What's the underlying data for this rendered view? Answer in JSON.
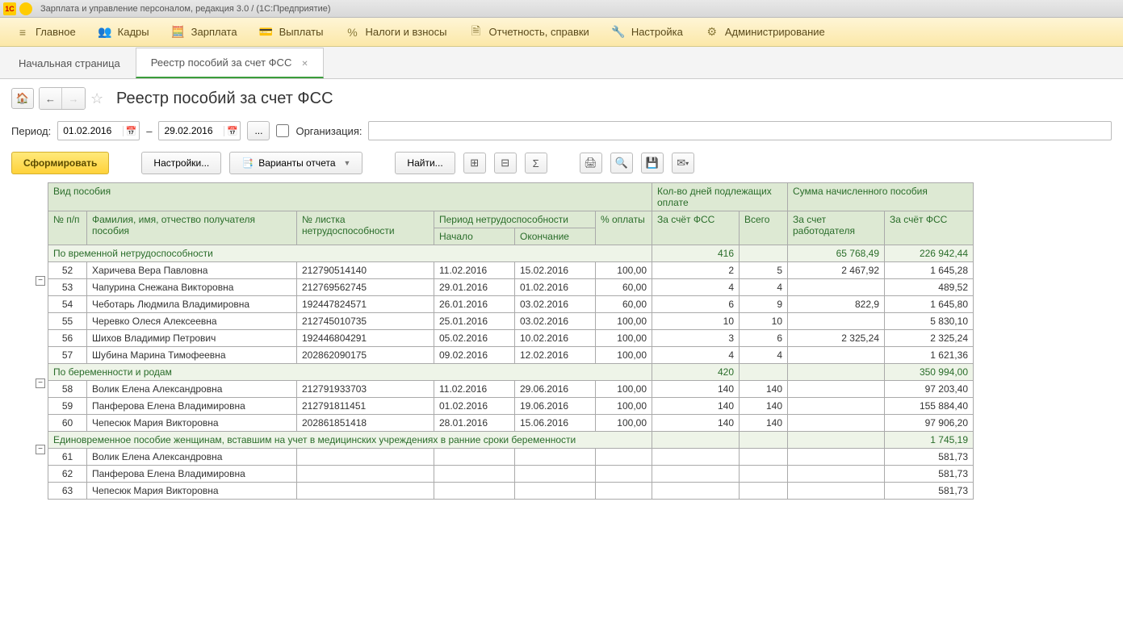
{
  "window": {
    "title": "Зарплата и управление персоналом, редакция 3.0 /                                  (1С:Предприятие)"
  },
  "menu": {
    "items": [
      "Главное",
      "Кадры",
      "Зарплата",
      "Выплаты",
      "Налоги и взносы",
      "Отчетность, справки",
      "Настройка",
      "Администрирование"
    ]
  },
  "tabs": {
    "home": "Начальная страница",
    "active": "Реестр пособий за счет ФСС"
  },
  "page": {
    "title": "Реестр пособий за счет ФСС"
  },
  "filter": {
    "period_label": "Период:",
    "date_from": "01.02.2016",
    "dash": "–",
    "date_to": "29.02.2016",
    "more": "...",
    "org_label": "Организация:"
  },
  "toolbar": {
    "form": "Сформировать",
    "settings": "Настройки...",
    "variants": "Варианты отчета",
    "find": "Найти..."
  },
  "headers": {
    "vid": "Вид пособия",
    "days_group": "Кол-во дней подлежащих оплате",
    "sum_group": "Сумма начисленного пособия",
    "npp": "№ п/п",
    "fio": "Фамилия, имя, отчество получателя пособия",
    "listok": "№ листка нетрудоспособности",
    "period": "Период нетрудоспособности",
    "start": "Начало",
    "end": "Окончание",
    "pct": "% оплаты",
    "days_fss": "За счёт ФСС",
    "days_total": "Всего",
    "sum_emp": "За счет работодателя",
    "sum_fss": "За счёт ФСС"
  },
  "groups": [
    {
      "title": "По временной нетрудоспособности",
      "days_fss": "416",
      "sum_emp": "65 768,49",
      "sum_fss": "226 942,44",
      "rows": [
        {
          "n": "52",
          "fio": "Харичева Вера  Павловна",
          "list": "212790514140",
          "start": "11.02.2016",
          "end": "15.02.2016",
          "pct": "100,00",
          "d1": "2",
          "d2": "5",
          "s1": "2 467,92",
          "s2": "1 645,28"
        },
        {
          "n": "53",
          "fio": "Чапурина Снежана Викторовна",
          "list": "212769562745",
          "start": "29.01.2016",
          "end": "01.02.2016",
          "pct": "60,00",
          "d1": "4",
          "d2": "4",
          "s1": "",
          "s2": "489,52"
        },
        {
          "n": "54",
          "fio": "Чеботарь Людмила Владимировна",
          "list": "192447824571",
          "start": "26.01.2016",
          "end": "03.02.2016",
          "pct": "60,00",
          "d1": "6",
          "d2": "9",
          "s1": "822,9",
          "s2": "1 645,80"
        },
        {
          "n": "55",
          "fio": "Черевко Олеся Алексеевна",
          "list": "212745010735",
          "start": "25.01.2016",
          "end": "03.02.2016",
          "pct": "100,00",
          "d1": "10",
          "d2": "10",
          "s1": "",
          "s2": "5 830,10"
        },
        {
          "n": "56",
          "fio": "Шихов Владимир Петрович",
          "list": "192446804291",
          "start": "05.02.2016",
          "end": "10.02.2016",
          "pct": "100,00",
          "d1": "3",
          "d2": "6",
          "s1": "2 325,24",
          "s2": "2 325,24"
        },
        {
          "n": "57",
          "fio": "Шубина Марина Тимофеевна",
          "list": "202862090175",
          "start": "09.02.2016",
          "end": "12.02.2016",
          "pct": "100,00",
          "d1": "4",
          "d2": "4",
          "s1": "",
          "s2": "1 621,36"
        }
      ]
    },
    {
      "title": "По беременности и родам",
      "days_fss": "420",
      "sum_emp": "",
      "sum_fss": "350 994,00",
      "rows": [
        {
          "n": "58",
          "fio": "Волик Елена Александровна",
          "list": "212791933703",
          "start": "11.02.2016",
          "end": "29.06.2016",
          "pct": "100,00",
          "d1": "140",
          "d2": "140",
          "s1": "",
          "s2": "97 203,40"
        },
        {
          "n": "59",
          "fio": "Панферова Елена Владимировна",
          "list": "212791811451",
          "start": "01.02.2016",
          "end": "19.06.2016",
          "pct": "100,00",
          "d1": "140",
          "d2": "140",
          "s1": "",
          "s2": "155 884,40"
        },
        {
          "n": "60",
          "fio": "Чепесюк Мария Викторовна",
          "list": "202861851418",
          "start": "28.01.2016",
          "end": "15.06.2016",
          "pct": "100,00",
          "d1": "140",
          "d2": "140",
          "s1": "",
          "s2": "97 906,20"
        }
      ]
    },
    {
      "title": "Единовременное пособие женщинам, вставшим на учет в медицинских учреждениях в ранние сроки беременности",
      "days_fss": "",
      "sum_emp": "",
      "sum_fss": "1 745,19",
      "rows": [
        {
          "n": "61",
          "fio": "Волик Елена Александровна",
          "list": "",
          "start": "",
          "end": "",
          "pct": "",
          "d1": "",
          "d2": "",
          "s1": "",
          "s2": "581,73"
        },
        {
          "n": "62",
          "fio": "Панферова Елена Владимировна",
          "list": "",
          "start": "",
          "end": "",
          "pct": "",
          "d1": "",
          "d2": "",
          "s1": "",
          "s2": "581,73"
        },
        {
          "n": "63",
          "fio": "Чепесюк Мария Викторовна",
          "list": "",
          "start": "",
          "end": "",
          "pct": "",
          "d1": "",
          "d2": "",
          "s1": "",
          "s2": "581,73"
        }
      ]
    }
  ]
}
